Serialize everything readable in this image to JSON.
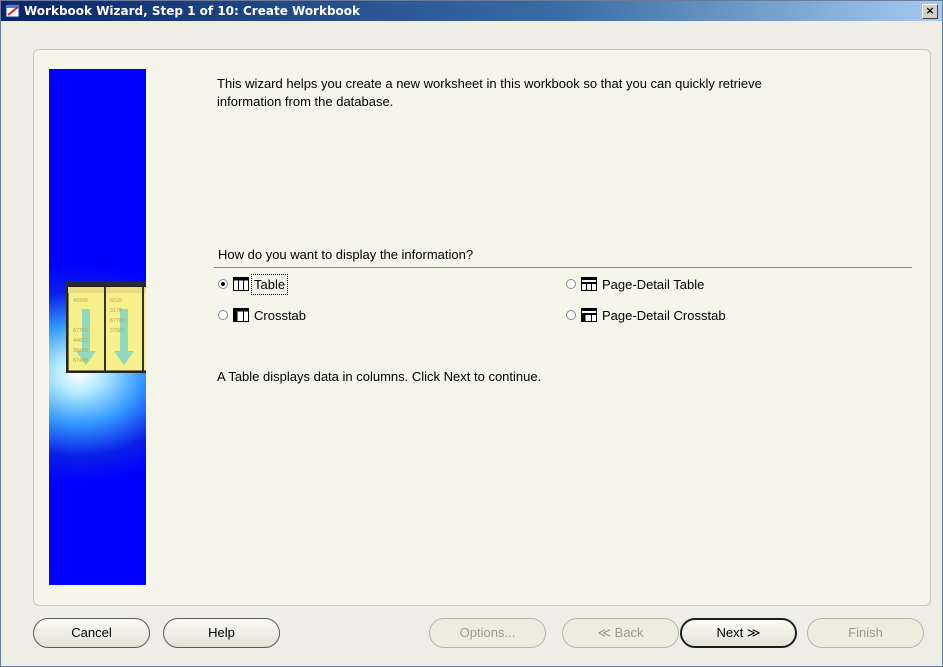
{
  "window": {
    "title": "Workbook Wizard, Step 1 of 10: Create Workbook",
    "close_label": "×"
  },
  "intro": {
    "line1": "This wizard helps you create a new worksheet in this workbook so that you can quickly retrieve",
    "line2": "information from the database."
  },
  "display": {
    "question": "How do you want to display the information?",
    "options": [
      {
        "label": "Table",
        "checked": true,
        "icon": "table-icon"
      },
      {
        "label": "Page-Detail Table",
        "checked": false,
        "icon": "page-detail-table-icon"
      },
      {
        "label": "Crosstab",
        "checked": false,
        "icon": "crosstab-icon"
      },
      {
        "label": "Page-Detail Crosstab",
        "checked": false,
        "icon": "page-detail-crosstab-icon"
      }
    ],
    "description": "A Table displays data in columns. Click Next to continue."
  },
  "illustration": {
    "columns": [
      [
        "40306",
        "",
        "",
        "67709",
        "44671",
        "30489",
        "67489"
      ],
      [
        "6520",
        "3176",
        "67785",
        "37881",
        "",
        "",
        ""
      ],
      [
        "6742",
        "5198",
        "4563",
        "45085",
        "",
        "",
        ""
      ]
    ]
  },
  "buttons": {
    "cancel": "Cancel",
    "help": "Help",
    "options": "Options...",
    "back": "Back",
    "next": "Next",
    "finish": "Finish"
  },
  "colors": {
    "accent": "#0a246a",
    "side_panel": "#0000ff",
    "background": "#eeeee6"
  }
}
